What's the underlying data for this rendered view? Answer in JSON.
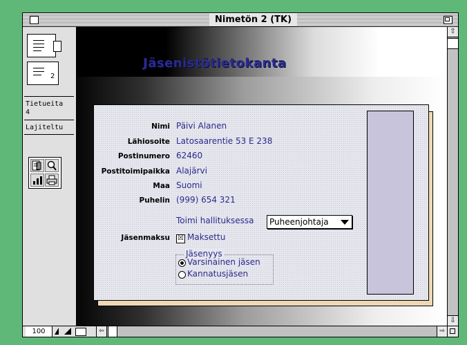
{
  "window": {
    "title": "Nimetön 2 (TK)"
  },
  "status_panel": {
    "page_number": "2",
    "records_label": "Tietueita",
    "records_count": "4",
    "sort_status": "Lajiteltu"
  },
  "layout": {
    "title": "Jäsenistötietokanta",
    "fields": [
      {
        "label": "Nimi",
        "value": "Päivi Alanen"
      },
      {
        "label": "Lähiosoite",
        "value": "Latosaarentie 53 E 238"
      },
      {
        "label": "Postinumero",
        "value": "62460"
      },
      {
        "label": "Postitoimipaikka",
        "value": "Alajärvi"
      },
      {
        "label": "Maa",
        "value": "Suomi"
      },
      {
        "label": "Puhelin",
        "value": "(999) 654 321"
      }
    ],
    "board_label": "Toimi hallituksessa",
    "board_value": "Puheenjohtaja",
    "fee_label": "Jäsenmaksu",
    "fee_checkbox_label": "Maksettu",
    "fee_checked": true,
    "membership": {
      "title": "Jäsenyys",
      "options": [
        "Varsinainen jäsen",
        "Kannatusjäsen"
      ],
      "selected": "Varsinainen jäsen"
    }
  },
  "bottom_bar": {
    "zoom": "100"
  },
  "icons": {
    "checkbox_mark": "☒",
    "scroll_up": "⇧",
    "scroll_down": "⇩",
    "scroll_left": "⇦",
    "scroll_right": "⇨"
  },
  "colors": {
    "background": "#5fb877",
    "value_text": "#2a2a8c",
    "card_shadow": "#eed9b4",
    "side_box": "#c8c4dc"
  }
}
